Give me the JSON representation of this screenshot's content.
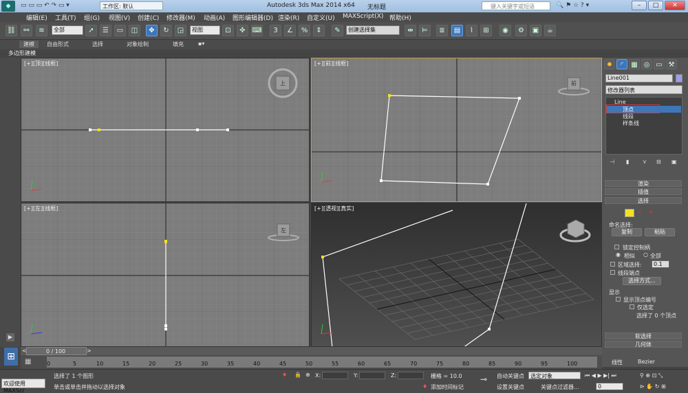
{
  "titlebar": {
    "workspace_label": "工作区: 默认",
    "app_title": "Autodesk 3ds Max  2014 x64",
    "doc_title": "无标题",
    "search_placeholder": "键入关键字或短语"
  },
  "menu": [
    "编辑(E)",
    "工具(T)",
    "组(G)",
    "视图(V)",
    "创建(C)",
    "修改器(M)",
    "动画(A)",
    "图形编辑器(D)",
    "渲染(R)",
    "自定义(U)",
    "MAXScript(X)",
    "帮助(H)"
  ],
  "toolbar": {
    "filter_value": "全部",
    "refcoord_value": "视图",
    "selset_value": "创建选择集"
  },
  "ribbon": {
    "tabs": [
      "建模",
      "自由形式",
      "选择",
      "对象绘制",
      "填充"
    ],
    "sub_label": "多边形建模"
  },
  "viewports": {
    "top_left": "[+][顶][线框]",
    "top_right": "[+][前][线框]",
    "bottom_left": "[+][左][线框]",
    "bottom_right": "[+][透视][真实]",
    "viewcube_top": "上",
    "viewcube_front": "前",
    "viewcube_left": "左"
  },
  "panel": {
    "object_name": "Line001",
    "modifier_list": "修改器列表",
    "stack": [
      "Line",
      "顶点",
      "线段",
      "样条线"
    ],
    "rollouts": {
      "render": "渲染",
      "interp": "插值",
      "select": "选择",
      "soft": "软选择",
      "geom": "几何体"
    },
    "named_sel_label": "命名选择:",
    "copy_button": "复制",
    "paste_button": "粘贴",
    "lock_handles": "锁定控制柄",
    "opt_similar": "相似",
    "opt_all": "全部",
    "area_select": "区域选择:",
    "area_value": "0.1",
    "segment_end": "线段端点",
    "select_by": "选择方式...",
    "display_label": "显示",
    "show_vertex_numbers": "显示顶点编号",
    "only_selected": "仅选定",
    "selected_count": "选择了 0 个顶点",
    "interp_options": [
      "线性",
      "Bezier"
    ]
  },
  "timeline": {
    "frame_label": "0 / 100",
    "ticks": [
      "0",
      "5",
      "10",
      "15",
      "20",
      "25",
      "30",
      "35",
      "40",
      "45",
      "50",
      "55",
      "60",
      "65",
      "70",
      "75",
      "80",
      "85",
      "90",
      "95",
      "100"
    ]
  },
  "status": {
    "welcome": "欢迎使用 MAXScr",
    "selected_line": "选择了 1 个图形",
    "prompt_line": "单击或单击并拖动以选择对象",
    "x_label": "X:",
    "y_label": "Y:",
    "z_label": "Z:",
    "grid_label": "栅格 = 10.0",
    "add_time_tag": "添加时间标记",
    "auto_key": "自动关键点",
    "set_key": "设置关键点",
    "key_mode_value": "选定对象",
    "key_filters": "关键点过滤器...",
    "frame_value": "0"
  },
  "colors": {
    "viewport_bg": "#7d7d7d",
    "active_border": "#c9a347",
    "selection_blue": "#3e76b8",
    "vertex_yellow": "#f3e21d",
    "highlight_red": "#d23a3a"
  }
}
